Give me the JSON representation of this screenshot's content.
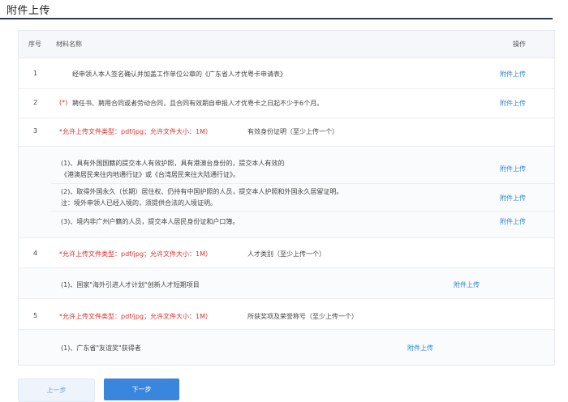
{
  "page": {
    "title": "附件上传"
  },
  "table": {
    "headers": {
      "index": "序号",
      "material": "材料名称",
      "action": "操作"
    }
  },
  "rows": [
    {
      "index": "1",
      "text": "经申领人本人签名确认并加盖工作单位公章的《广东省人才优粤卡申请表》",
      "action": "附件上传"
    },
    {
      "index": "2",
      "required_mark": "(*)",
      "text": "聘任书、聘用合同或者劳动合同，且合同有效期自申报人才优粤卡之日起不少于6个月。",
      "action": "附件上传"
    },
    {
      "index": "3",
      "hint": "*允许上传文件类型：pdf/jpg；允许文件大小：1M）",
      "text": "有效身份证明（至少上传一个）",
      "subs": [
        {
          "line1": "(1)、具有外国国籍的提交本人有效护照，具有港澳台身份的，提交本人有效的",
          "line2": "《港澳居民来往内地通行证》或《台湾居民来往大陆通行证》。",
          "action": "附件上传"
        },
        {
          "line1": "(2)、取得外国永久（长期）居住权、仍持有中国护照的人员，提交本人护照和外国永久居留证明。",
          "line2": "注：境外申领人已经入境的，须提供合法的入境证明。",
          "action": "附件上传"
        },
        {
          "line1": "(3)、境内非广州户籍的人员，提交本人居民身份证和户口簿。",
          "action": "附件上传"
        }
      ]
    },
    {
      "index": "4",
      "hint": "*允许上传文件类型：pdf/jpg；允许文件大小：1M）",
      "text": "人才类别（至少上传一个）",
      "subs": [
        {
          "line1": "(1)、国家\"海外引进人才计划\"创新人才短期项目",
          "action": "附件上传"
        }
      ]
    },
    {
      "index": "5",
      "hint": "*允许上传文件类型：pdf/jpg；允许文件大小：1M）",
      "text": "所获奖项及荣誉称号（至少上传一个）",
      "subs": [
        {
          "line1": "(1)、广东省\"友谊奖\"获得者",
          "action": "附件上传"
        }
      ]
    }
  ],
  "footer": {
    "prev": "上一步",
    "next": "下一步"
  },
  "colors": {
    "accent": "#3a86dc",
    "required": "#d9302b",
    "link": "#2f86d8"
  }
}
